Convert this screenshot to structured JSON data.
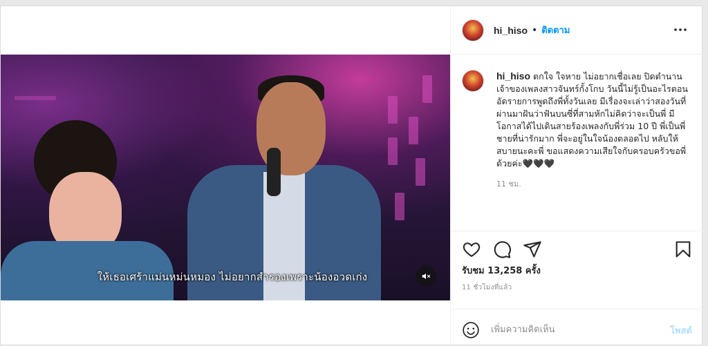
{
  "post": {
    "username": "hi_hiso",
    "follow_label": "ติดตาม",
    "dot": "•",
    "caption_text": "ตกใจ ใจหาย ไม่อยากเชื่อเลย ปิดตำนานเจ้าของเพลงสาวจันทร์กั้งโกบ วันนี้ไม่รู้เป็นอะไรตอนอัดรายการพูดถึงพี่ทั้งวันเลย มีเรื่องจะเล่าว่าสองวันที่ผ่านมาฝันว่าฟันบนซี่ที่สามหักไม่คิดว่าจะเป็นพี่ มีโอกาสได้ไปเดินสายร้องเพลงกับพี่ร่วม 10 ปี พี่เป็นพี่ชายที่น่ารักมาก พี่จะอยู่ในใจน้องตลอดไป หลับให้สบายนะคะพี่ ขอแสดงความเสียใจกับครอบครัวขอพี่ด้วยค่ะ🖤🖤🖤",
    "caption_time": "11 ชม.",
    "views": "รับชม 13,258 ครั้ง",
    "posted_ago": "11 ชั่วโมงที่แล้ว",
    "comment_placeholder": "เพิ่มความคิดเห็น",
    "post_button": "โพสต์"
  },
  "video": {
    "subtitle": "ให้เธอเศร้าแม่นหม่นหมอง  ไม่อยากสำรองเพราะน้องอวดเก่ง",
    "muted": true
  },
  "icons": {
    "more": "more-horizontal-icon",
    "like": "heart-icon",
    "comment": "comment-icon",
    "share": "share-icon",
    "save": "bookmark-icon",
    "emoji": "emoji-icon",
    "mute": "speaker-muted-icon"
  },
  "colors": {
    "link_blue": "#0095f6",
    "post_disabled": "#b2dffc",
    "text": "#262626",
    "muted_text": "#8e8e8e"
  }
}
